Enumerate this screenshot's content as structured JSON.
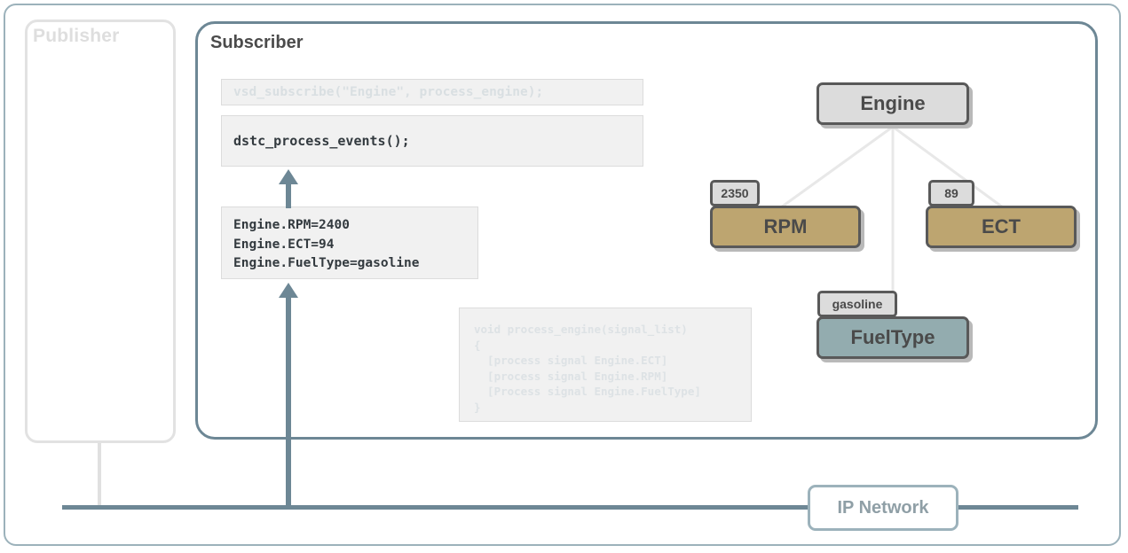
{
  "diagram": {
    "publisher": {
      "label": "Publisher"
    },
    "subscriber": {
      "label": "Subscriber",
      "code_faded": "vsd_subscribe(\"Engine\", process_engine);",
      "code_active": "dstc_process_events();",
      "signal_list": "Engine.RPM=2400\nEngine.ECT=94\nEngine.FuelType=gasoline",
      "handler_code": "void process_engine(signal_list)\n{\n  [process signal Engine.ECT]\n  [process signal Engine.RPM]\n  [Process signal Engine.FuelType]\n}"
    },
    "network": {
      "label": "IP Network"
    },
    "signal_tree": {
      "root": {
        "name": "Engine",
        "value": ""
      },
      "children": [
        {
          "name": "RPM",
          "value": "2350"
        },
        {
          "name": "ECT",
          "value": "89"
        },
        {
          "name": "FuelType",
          "value": "gasoline"
        }
      ]
    },
    "colors": {
      "accent_blue": "#6d8795",
      "frame_blue": "#9cb2bb",
      "node_gray": "#dcdcdc",
      "node_tan": "#bda570",
      "node_teal": "#93acaf",
      "node_border": "#595959",
      "faded_gray": "#dedede",
      "code_bg": "#f1f1f1"
    }
  }
}
